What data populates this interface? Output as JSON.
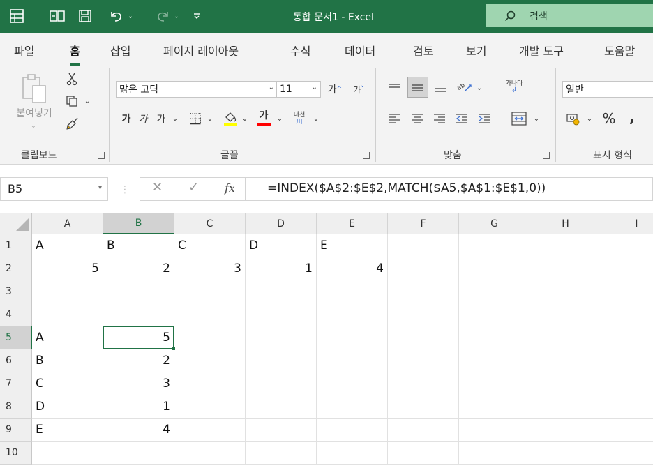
{
  "app": {
    "doc_title": "통합 문서1  -  Excel",
    "search_label": "검색"
  },
  "tabs": [
    "파일",
    "홈",
    "삽입",
    "페이지 레이아웃",
    "수식",
    "데이터",
    "검토",
    "보기",
    "개발 도구",
    "도움말"
  ],
  "active_tab": "홈",
  "ribbon": {
    "clipboard": {
      "paste_label": "붙여넣기",
      "group_label": "클립보드"
    },
    "font": {
      "font_name": "맑은 고딕",
      "font_size": "11",
      "grow_label": "가",
      "shrink_label": "가",
      "bold_label": "가",
      "italic_label": "가",
      "underline_label": "가",
      "font_color_label": "가",
      "phonetic_label": "내천",
      "group_label": "글꼴"
    },
    "alignment": {
      "group_label": "맞춤",
      "wrap_label": "가나다"
    },
    "number": {
      "format": "일반",
      "percent_label": "%",
      "comma_label": ",",
      "group_label": "표시 형식"
    }
  },
  "formula_bar": {
    "name_box": "B5",
    "fx_label": "fx",
    "formula": "=INDEX($A$2:$E$2,MATCH($A5,$A$1:$E$1,0))"
  },
  "grid": {
    "columns": [
      "A",
      "B",
      "C",
      "D",
      "E",
      "F",
      "G",
      "H",
      "I"
    ],
    "rows": [
      "1",
      "2",
      "3",
      "4",
      "5",
      "6",
      "7",
      "8",
      "9",
      "10"
    ],
    "selected_column": "B",
    "selected_row": "5",
    "cells": {
      "A1": "A",
      "B1": "B",
      "C1": "C",
      "D1": "D",
      "E1": "E",
      "A2": "5",
      "B2": "2",
      "C2": "3",
      "D2": "1",
      "E2": "4",
      "A5": "A",
      "B5": "5",
      "A6": "B",
      "B6": "2",
      "A7": "C",
      "B7": "3",
      "A8": "D",
      "B8": "1",
      "A9": "E",
      "B9": "4"
    },
    "numeric_cells": [
      "A2",
      "B2",
      "C2",
      "D2",
      "E2",
      "B5",
      "B6",
      "B7",
      "B8",
      "B9"
    ],
    "active_cell": "B5"
  },
  "colors": {
    "brand": "#217346",
    "highlight_yellow": "#ffff00",
    "font_red": "#ff0000"
  }
}
